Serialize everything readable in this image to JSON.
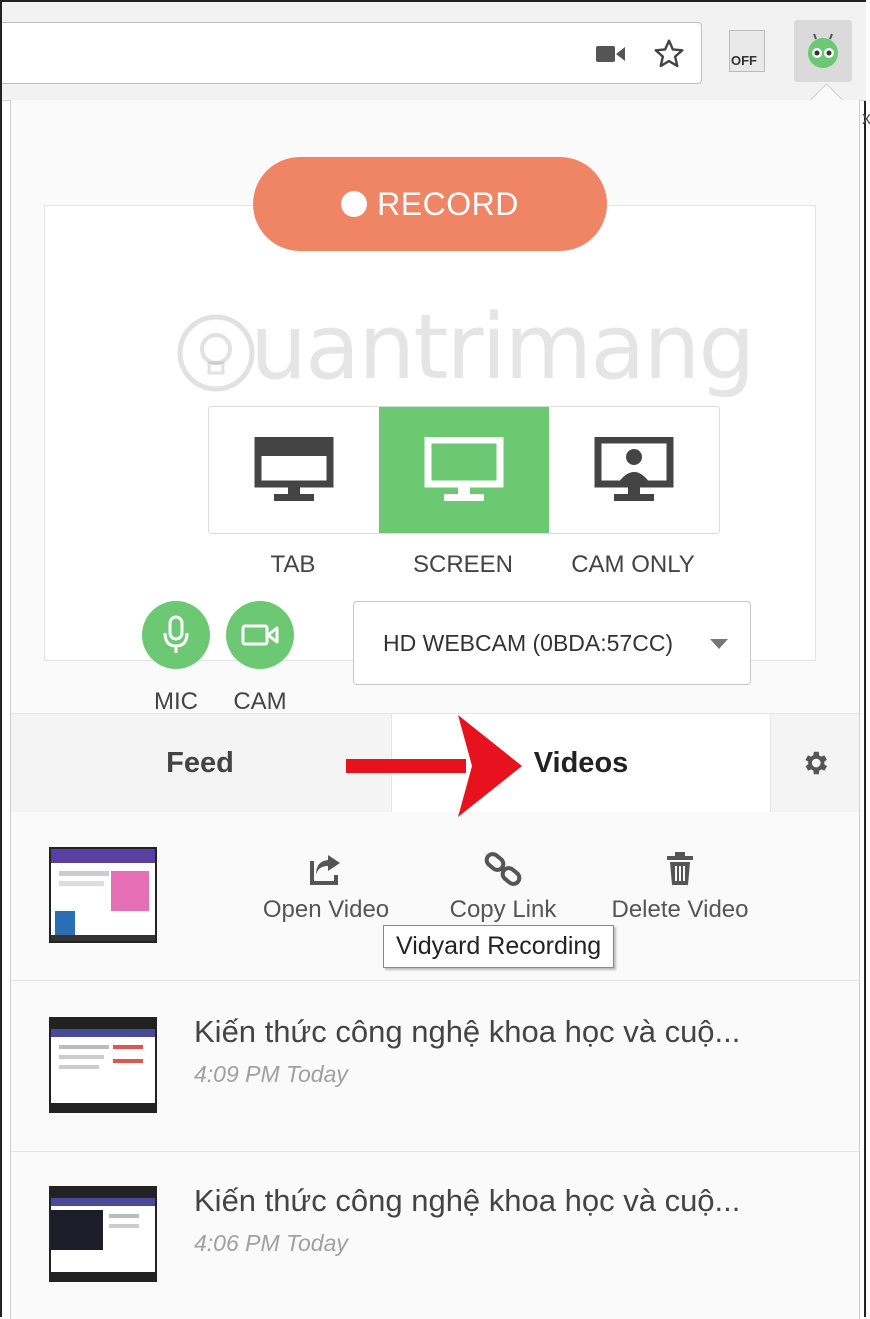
{
  "browser": {
    "extension_off_label": "OFF",
    "side_close": "x"
  },
  "recorder": {
    "record_label": "RECORD",
    "modes": [
      {
        "label": "TAB",
        "active": false
      },
      {
        "label": "SCREEN",
        "active": true
      },
      {
        "label": "CAM ONLY",
        "active": false
      }
    ],
    "mic_label": "MIC",
    "cam_label": "CAM",
    "camera_select": "HD WEBCAM (0BDA:57CC)"
  },
  "watermark": "uantrimang",
  "tabs": {
    "feed": "Feed",
    "videos": "Videos"
  },
  "latest_video": {
    "actions": {
      "open": "Open Video",
      "copy": "Copy Link",
      "delete": "Delete Video"
    },
    "tooltip": "Vidyard Recording"
  },
  "videos": [
    {
      "title": "Kiến thức công nghệ khoa học và cuộ...",
      "time": "4:09 PM Today"
    },
    {
      "title": "Kiến thức công nghệ khoa học và cuộ...",
      "time": "4:06 PM Today"
    }
  ],
  "colors": {
    "record": "#f08566",
    "active_green": "#6cc872",
    "arrow_red": "#e8121e"
  }
}
